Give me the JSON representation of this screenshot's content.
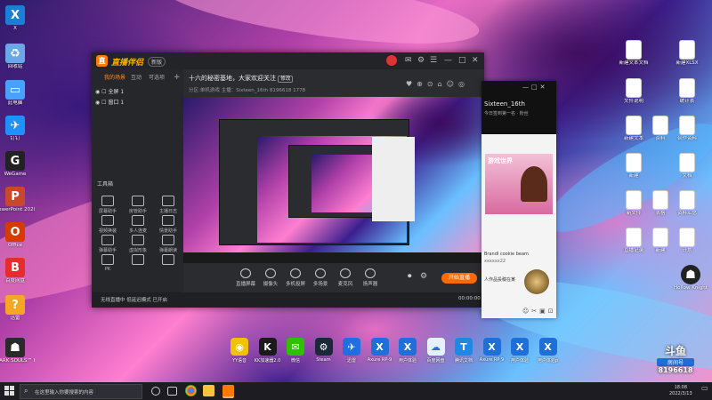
{
  "desktop_left": [
    {
      "label": "X",
      "name": "app-x",
      "color": "#1a7fd6",
      "glyph": "X"
    },
    {
      "label": "回收站",
      "name": "recycle-bin",
      "color": "#6aa7e8",
      "glyph": "♻"
    },
    {
      "label": "此电脑",
      "name": "this-pc",
      "color": "#4aa0ff",
      "glyph": "▭"
    },
    {
      "label": "钉钉",
      "name": "dingtalk",
      "color": "#1e90ff",
      "glyph": "✈"
    },
    {
      "label": "WeGame",
      "name": "wegame",
      "color": "#222",
      "glyph": "G"
    },
    {
      "label": "PowerPoint 2020",
      "name": "powerpoint",
      "color": "#c9472a",
      "glyph": "P"
    },
    {
      "label": "Office",
      "name": "office",
      "color": "#d83b01",
      "glyph": "O"
    },
    {
      "label": "百度网盘",
      "name": "baidu-netdisk",
      "color": "#e52d2d",
      "glyph": "B"
    },
    {
      "label": "迅雷",
      "name": "xunlei",
      "color": "#f5a623",
      "glyph": "?"
    },
    {
      "label": "DARK SOULS™ III",
      "name": "dark-souls",
      "color": "#2a2a2a",
      "glyph": "☗"
    }
  ],
  "app": {
    "name": "直播伴侣",
    "version": "新版",
    "left_tabs": [
      "我的场景",
      "互动",
      "可选项"
    ],
    "scenes": [
      "全屏 1",
      "窗口 1"
    ],
    "tools_label": "工具箱",
    "tools": [
      "屏幕助手",
      "房管助手",
      "主播日志",
      "视频换装",
      "多人连麦",
      "情景助手",
      "弹幕助手",
      "虚拟形象",
      "弹幕朗读",
      "PK",
      "",
      ""
    ],
    "stream_title": "十六的秘密基地，大家欢迎关注",
    "stream_badge": "修改",
    "stream_sub": "分区:单机游戏   主播：Sixteen_16th   8196618   1778",
    "controls": [
      "直播屏幕",
      "摄像头",
      "多机投屏",
      "多场景",
      "麦克风",
      "扬声器"
    ],
    "live_btn": "开始直播",
    "status_text": "无线直播中 低延迟模式 已开启",
    "timer": "00:00:00"
  },
  "chat": {
    "name": "Sixteen_16th",
    "sub": "今日签到第一名 · 粉丝",
    "banner": "游戏世界",
    "msg1": "Brandl cookie beam",
    "msg2": "xxxxxx22",
    "msg3": "人作品投稿在某",
    "buttons": [
      "—",
      "□",
      "✕"
    ]
  },
  "desktop_right": [
    {
      "label": "新建文本文档",
      "name": "doc-1",
      "kind": "doc"
    },
    {
      "label": "新建XLSX",
      "name": "xlsx-1",
      "kind": "xdoc"
    },
    {
      "label": "文件说明",
      "name": "doc-2",
      "kind": "doc"
    },
    {
      "label": "统计表",
      "name": "xls-1",
      "kind": "xls"
    },
    {
      "label": "资料",
      "name": "doc-3",
      "kind": "doc"
    },
    {
      "label": "新建文本",
      "name": "doc-4",
      "kind": "doc"
    },
    {
      "label": "合作资料",
      "name": "xls-2",
      "kind": "xls"
    },
    {
      "label": "新建",
      "name": "xdoc-2",
      "kind": "xdoc"
    },
    {
      "label": "文档",
      "name": "doc-5",
      "kind": "doc"
    },
    {
      "label": "新文件",
      "name": "xdoc-3",
      "kind": "xdoc"
    },
    {
      "label": "表格",
      "name": "xls-3",
      "kind": "xls"
    },
    {
      "label": "资料汇总",
      "name": "doc-6",
      "kind": "doc"
    },
    {
      "label": "直播记录",
      "name": "xdoc-4",
      "kind": "xdoc"
    },
    {
      "label": "计划",
      "name": "xdoc-5",
      "kind": "xdoc"
    },
    {
      "label": "新建",
      "name": "doc-7",
      "kind": "doc"
    },
    {
      "label": "Hollow Knight",
      "name": "hollow-knight",
      "kind": "game"
    }
  ],
  "dock": [
    {
      "label": "YY语音",
      "color": "#f2c200",
      "glyph": "◉"
    },
    {
      "label": "KK加速器2.0",
      "color": "#1a1a1a",
      "glyph": "K"
    },
    {
      "label": "微信",
      "color": "#2dc100",
      "glyph": "✉"
    },
    {
      "label": "Steam",
      "color": "#1b2838",
      "glyph": "⚙"
    },
    {
      "label": "迅雷",
      "color": "#1f6fe0",
      "glyph": "✈"
    },
    {
      "label": "Axure RP-9",
      "color": "#1e6fd9",
      "glyph": "X"
    },
    {
      "label": "用户体验",
      "color": "#1e6fd9",
      "glyph": "X"
    },
    {
      "label": "百度网盘",
      "color": "#e6f0ff",
      "glyph": "☁"
    },
    {
      "label": "腾讯文档",
      "color": "#1e88e5",
      "glyph": "T"
    },
    {
      "label": "Axure RP 9",
      "color": "#1e6fd9",
      "glyph": "X"
    },
    {
      "label": "用户体验",
      "color": "#1e6fd9",
      "glyph": "X"
    },
    {
      "label": "用户体验p",
      "color": "#1e6fd9",
      "glyph": "X"
    }
  ],
  "douyu": {
    "logo": "斗鱼",
    "label": "房间号",
    "room_id": "8196618"
  },
  "taskbar": {
    "search_placeholder": "在这里输入你要搜索的内容",
    "clock_time": "18:08",
    "clock_date": "2022/3/13"
  }
}
